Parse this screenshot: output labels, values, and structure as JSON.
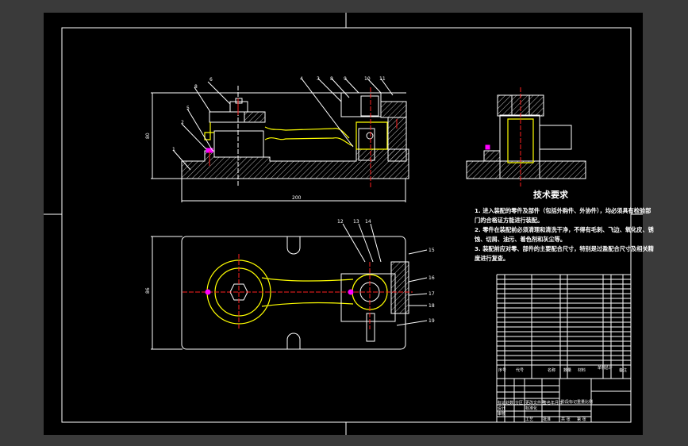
{
  "drawing": {
    "front_view_labels": [
      "6",
      "8",
      "5",
      "2",
      "1",
      "4",
      "3",
      "8",
      "9",
      "10",
      "11"
    ],
    "plan_view_labels": [
      "12",
      "13",
      "14",
      "15",
      "16",
      "17",
      "18",
      "19"
    ],
    "dimensions": {
      "front_width": "200",
      "front_height": "80",
      "plan_height": "86"
    },
    "tech_requirements": {
      "title": "技术要求",
      "lines": [
        "1. 进入装配的零件及部件（包括外购件、外协件），均必须具有检验部",
        "门的合格证方能进行装配。",
        "2. 零件在装配前必须清理和清洗干净，不得有毛刺、飞边、氧化皮、锈",
        "蚀、切屑、油污、着色剂和灰尘等。",
        "3. 装配前应对零、部件的主要配合尺寸，特别是过盈配合尺寸及相关精",
        "度进行复查。"
      ]
    },
    "bom_header": [
      "序号",
      "代号",
      "名称",
      "数量",
      "材料",
      "单件",
      "总计",
      "备注"
    ],
    "bom_rows": 19,
    "title_block": [
      "标记",
      "处数",
      "分区",
      "更改文件号",
      "签名",
      "年月日",
      "设计",
      "标准化",
      "阶段标记",
      "重量",
      "比例",
      "审核",
      "工艺",
      "批准",
      "共 张",
      "第 张"
    ]
  }
}
